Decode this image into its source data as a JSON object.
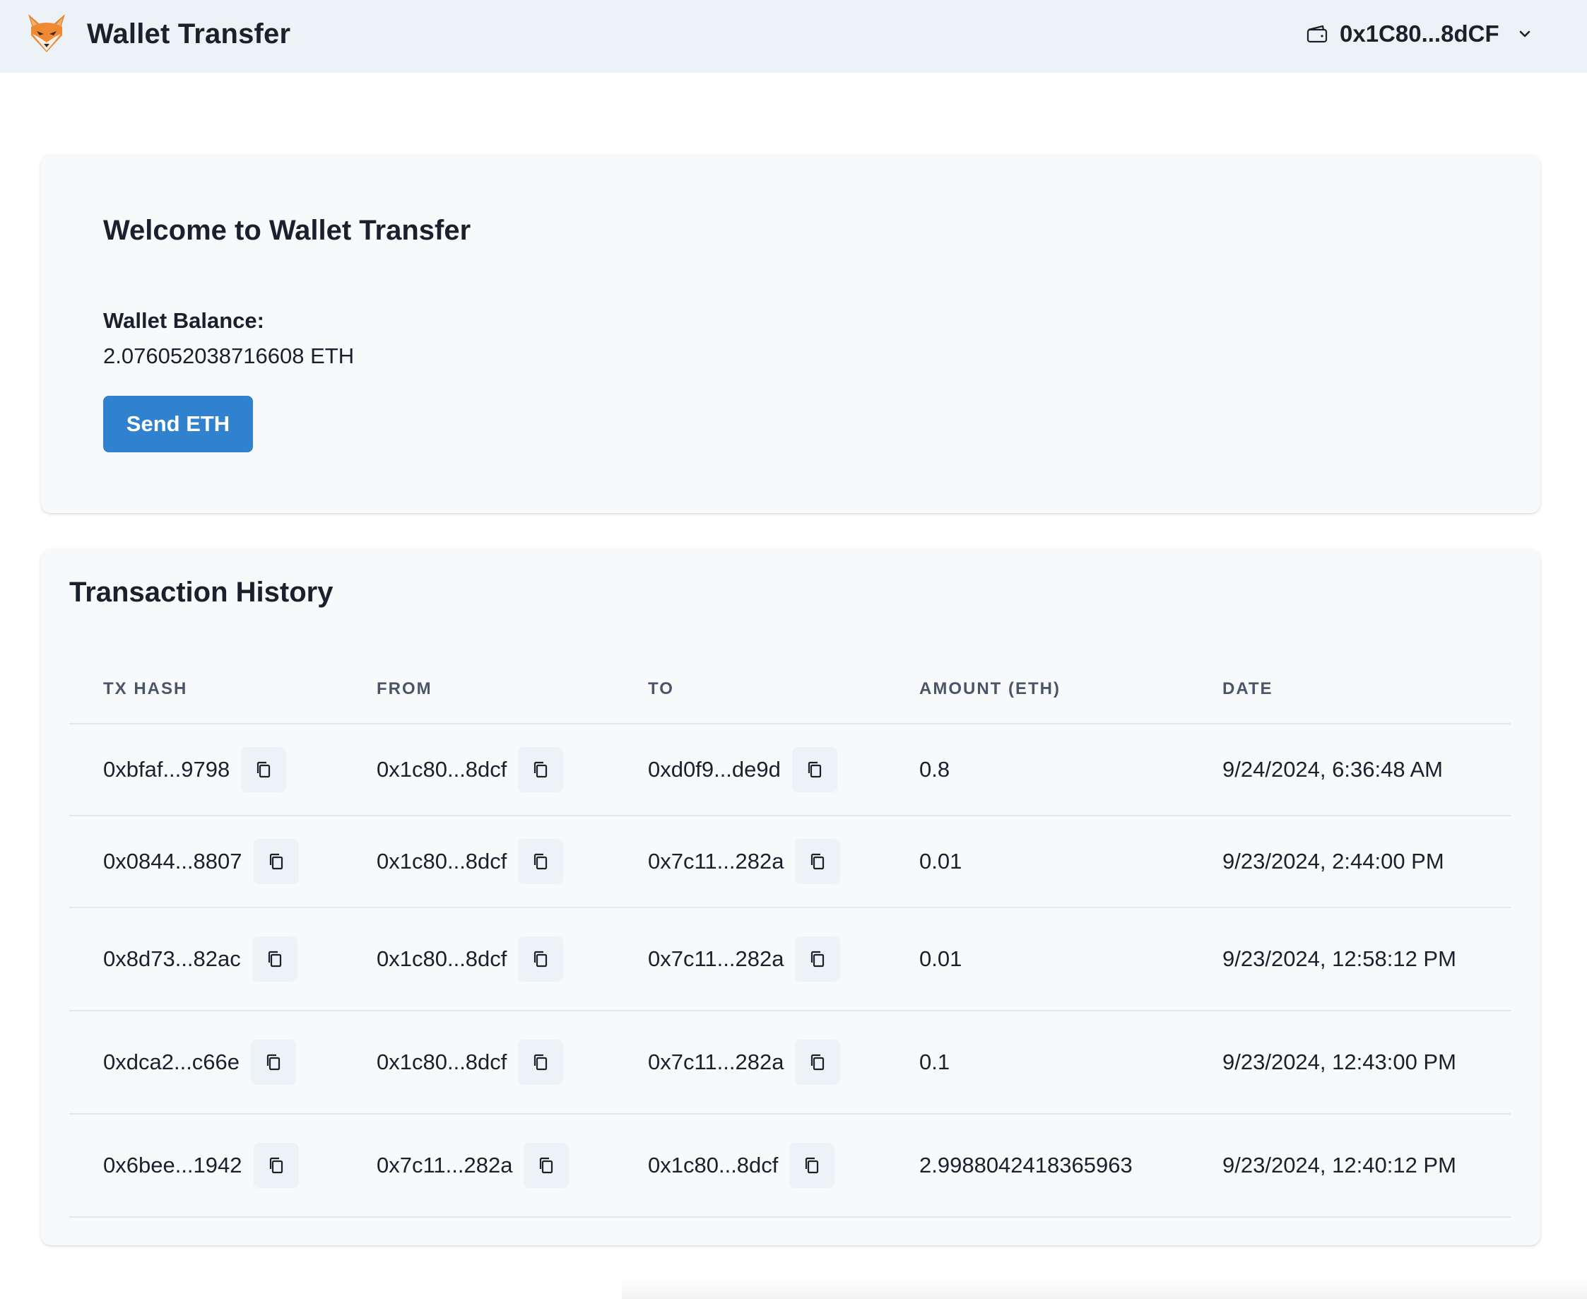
{
  "header": {
    "title": "Wallet Transfer",
    "logo_icon": "fox-logo-icon",
    "account": {
      "address": "0x1C80...8dCF",
      "wallet_icon": "wallet-icon",
      "dropdown_icon": "chevron-down-icon"
    }
  },
  "welcome": {
    "title": "Welcome to Wallet Transfer",
    "balance_label": "Wallet Balance:",
    "balance_value": "2.076052038716608 ETH",
    "send_button": "Send ETH"
  },
  "history": {
    "title": "Transaction History",
    "columns": [
      "TX HASH",
      "FROM",
      "TO",
      "AMOUNT (ETH)",
      "DATE"
    ],
    "copy_icon": "copy-icon",
    "rows": [
      {
        "hash": "0xbfaf...9798",
        "from": "0x1c80...8dcf",
        "to": "0xd0f9...de9d",
        "amount": "0.8",
        "date": "9/24/2024, 6:36:48 AM"
      },
      {
        "hash": "0x0844...8807",
        "from": "0x1c80...8dcf",
        "to": "0x7c11...282a",
        "amount": "0.01",
        "date": "9/23/2024, 2:44:00 PM"
      },
      {
        "hash": "0x8d73...82ac",
        "from": "0x1c80...8dcf",
        "to": "0x7c11...282a",
        "amount": "0.01",
        "date": "9/23/2024, 12:58:12 PM"
      },
      {
        "hash": "0xdca2...c66e",
        "from": "0x1c80...8dcf",
        "to": "0x7c11...282a",
        "amount": "0.1",
        "date": "9/23/2024, 12:43:00 PM"
      },
      {
        "hash": "0x6bee...1942",
        "from": "0x7c11...282a",
        "to": "0x1c80...8dcf",
        "amount": "2.9988042418365963",
        "date": "9/23/2024, 12:40:12 PM"
      }
    ]
  },
  "colors": {
    "header_bg": "#edf2f7",
    "card_bg": "#f7f9fb",
    "primary_button": "#3182ce",
    "text": "#1a202c",
    "muted_text": "#4a5568",
    "divider": "#e2e8f0"
  }
}
